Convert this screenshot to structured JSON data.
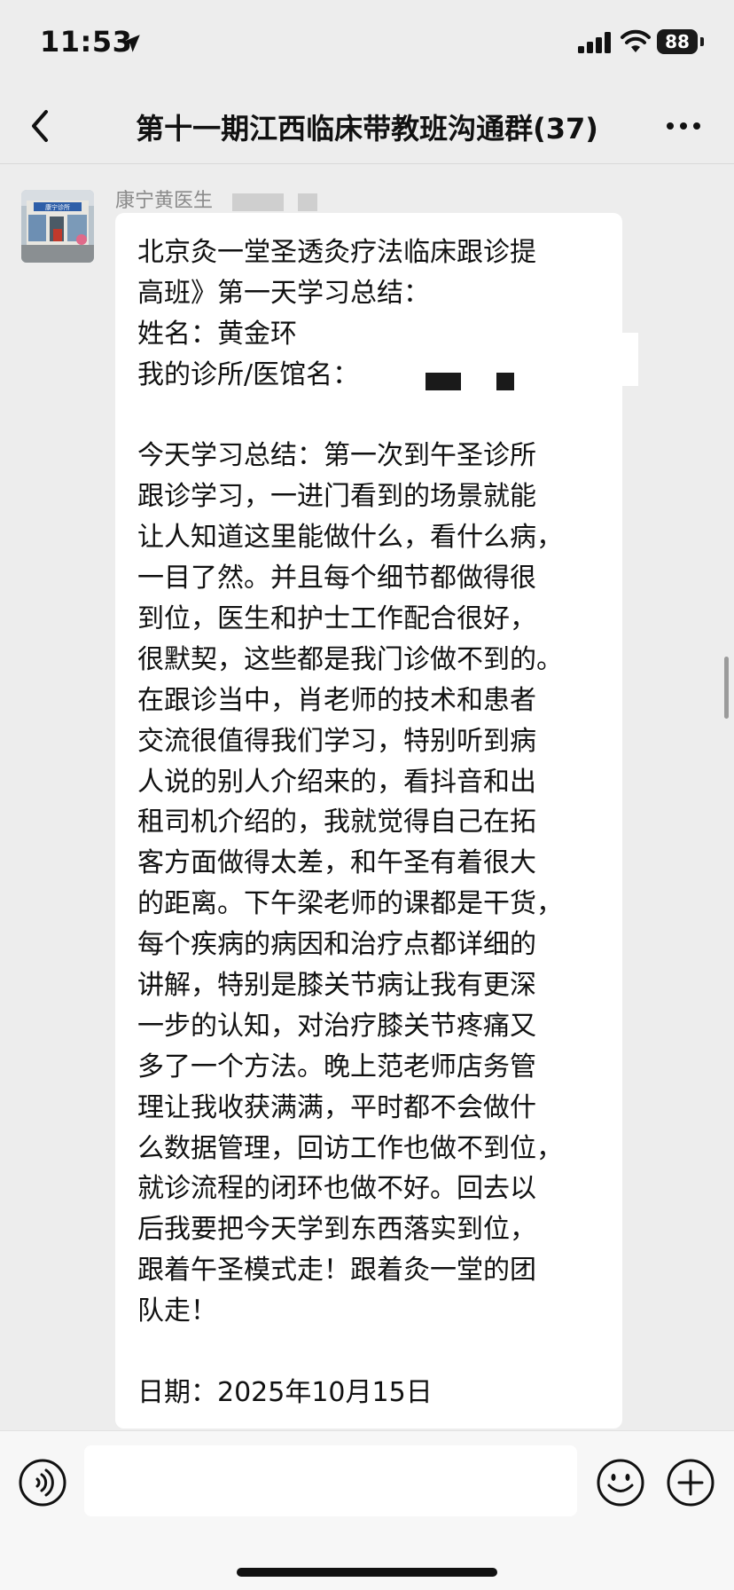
{
  "status_bar": {
    "time": "11:53",
    "battery": "88"
  },
  "nav": {
    "title": "第十一期江西临床带教班沟通群(37)"
  },
  "message": {
    "sender": "康宁黄医生",
    "lines": [
      "北京灸一堂圣透灸疗法临床跟诊提",
      "高班》第一天学习总结：",
      "姓名：黄金环",
      "我的诊所/医馆名：",
      "",
      "今天学习总结：第一次到午圣诊所",
      "跟诊学习，一进门看到的场景就能",
      "让人知道这里能做什么，看什么病，",
      "一目了然。并且每个细节都做得很",
      "到位，医生和护士工作配合很好，",
      "很默契，这些都是我门诊做不到的。",
      "在跟诊当中，肖老师的技术和患者",
      "交流很值得我们学习，特别听到病",
      "人说的别人介绍来的，看抖音和出",
      "租司机介绍的，我就觉得自己在拓",
      "客方面做得太差，和午圣有着很大",
      "的距离。下午梁老师的课都是干货，",
      "每个疾病的病因和治疗点都详细的",
      "讲解，特别是膝关节病让我有更深",
      "一步的认知，对治疗膝关节疼痛又",
      "多了一个方法。晚上范老师店务管",
      "理让我收获满满，平时都不会做什",
      "么数据管理，回访工作也做不到位，",
      "就诊流程的闭环也做不好。回去以",
      "后我要把今天学到东西落实到位，",
      "跟着午圣模式走！跟着灸一堂的团",
      "队走！",
      "",
      "日期：2025年10月15日"
    ]
  },
  "avatar": {
    "sign_text": "康宁诊所"
  },
  "input_bar": {
    "placeholder": ""
  },
  "colors": {
    "background": "#ededed",
    "bubble": "#ffffff",
    "sender": "#8a8a8a",
    "redaction": "#1a1a1a"
  },
  "icons": {
    "back": "chevron-left-icon",
    "more": "more-dots-icon",
    "voice": "voice-icon",
    "emoji": "emoji-icon",
    "plus": "plus-icon",
    "location": "location-arrow-icon",
    "signal": "signal-icon",
    "wifi": "wifi-icon",
    "battery": "battery-icon"
  }
}
